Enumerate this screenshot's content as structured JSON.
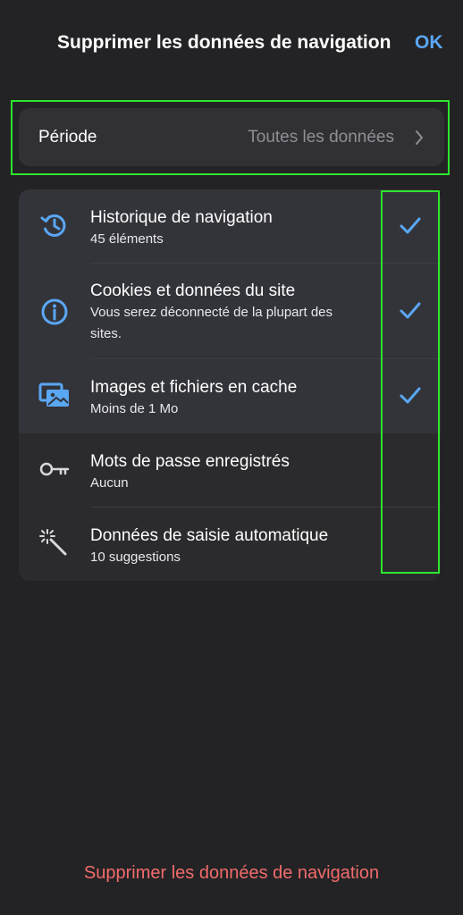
{
  "header": {
    "title": "Supprimer les données de navigation",
    "ok_label": "OK"
  },
  "period": {
    "label": "Période",
    "value": "Toutes les données",
    "chevron_icon": "chevron-right-icon"
  },
  "items": [
    {
      "title": "Historique de navigation",
      "subtitle": "45 éléments",
      "icon": "history-icon",
      "selected": true
    },
    {
      "title": "Cookies et données du site",
      "subtitle": "Vous serez déconnecté de la plupart des sites.",
      "icon": "info-icon",
      "selected": true
    },
    {
      "title": "Images et fichiers en cache",
      "subtitle": "Moins de 1 Mo",
      "icon": "images-icon",
      "selected": true
    },
    {
      "title": "Mots de passe enregistrés",
      "subtitle": "Aucun",
      "icon": "key-icon",
      "selected": false
    },
    {
      "title": "Données de saisie automatique",
      "subtitle": "10 suggestions",
      "icon": "magic-wand-icon",
      "selected": false
    }
  ],
  "footer": {
    "delete_label": "Supprimer les données de navigation"
  },
  "colors": {
    "background": "#232325",
    "accent_blue": "#5aa7f4",
    "destructive_red": "#f26b6b",
    "highlight_green": "#2ee62e"
  }
}
